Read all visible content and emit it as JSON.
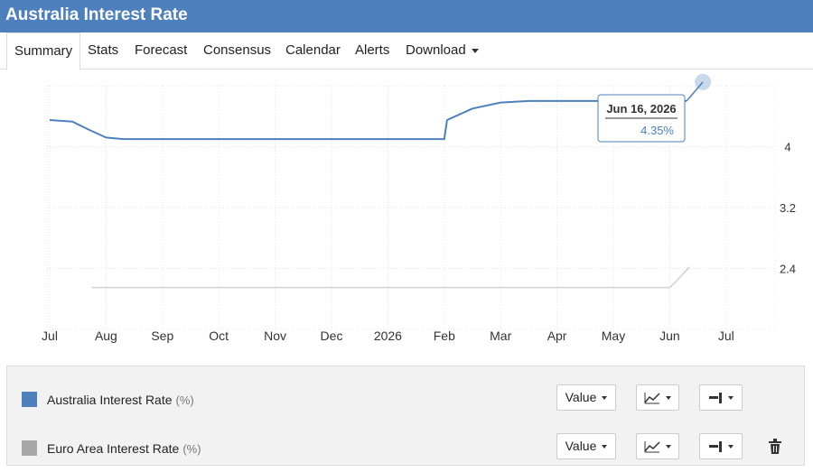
{
  "title": "Australia Interest Rate",
  "tabs": [
    {
      "label": "Summary"
    },
    {
      "label": "Stats"
    },
    {
      "label": "Forecast"
    },
    {
      "label": "Consensus"
    },
    {
      "label": "Calendar"
    },
    {
      "label": "Alerts"
    },
    {
      "label": "Download"
    }
  ],
  "tooltip": {
    "date": "Jun 16, 2026",
    "value": "4.35%"
  },
  "legend": [
    {
      "name": "Australia Interest Rate",
      "unit": "(%)",
      "color": "#4d80bd",
      "value_label": "Value"
    },
    {
      "name": "Euro Area Interest Rate",
      "unit": "(%)",
      "color": "#a6a6a6",
      "value_label": "Value"
    }
  ],
  "icons": {
    "chart_type": "line-chart-icon",
    "axis": "axis-side-icon",
    "delete": "trash-icon"
  },
  "chart_data": {
    "type": "line",
    "x_ticks": [
      "Jul",
      "Aug",
      "Sep",
      "Oct",
      "Nov",
      "Dec",
      "2026",
      "Feb",
      "Mar",
      "Apr",
      "May",
      "Jun",
      "Jul"
    ],
    "y_ticks": [
      "4",
      "3.2",
      "2.4"
    ],
    "ylim": [
      1.6,
      4.8
    ],
    "grid": true,
    "series": [
      {
        "name": "Australia Interest Rate",
        "color": "#4d80bd",
        "points": [
          [
            0,
            4.35
          ],
          [
            0.4,
            4.33
          ],
          [
            0.7,
            4.22
          ],
          [
            1.0,
            4.12
          ],
          [
            1.3,
            4.1
          ],
          [
            2,
            4.1
          ],
          [
            3,
            4.1
          ],
          [
            4,
            4.1
          ],
          [
            5,
            4.1
          ],
          [
            6,
            4.1
          ],
          [
            7,
            4.1
          ],
          [
            7.05,
            4.35
          ],
          [
            7.5,
            4.5
          ],
          [
            8,
            4.58
          ],
          [
            8.5,
            4.6
          ],
          [
            9,
            4.6
          ],
          [
            10,
            4.6
          ],
          [
            11,
            4.6
          ],
          [
            11.3,
            4.6
          ]
        ]
      },
      {
        "name": "Euro Area Interest Rate",
        "color": "#d0d0d0",
        "points": [
          [
            0.75,
            2.15
          ],
          [
            2,
            2.15
          ],
          [
            3,
            2.15
          ],
          [
            4,
            2.15
          ],
          [
            5,
            2.15
          ],
          [
            6,
            2.15
          ],
          [
            7,
            2.15
          ],
          [
            8,
            2.15
          ],
          [
            9,
            2.15
          ],
          [
            10,
            2.15
          ],
          [
            11,
            2.15
          ],
          [
            11.1,
            2.22
          ],
          [
            11.35,
            2.42
          ]
        ]
      }
    ]
  }
}
